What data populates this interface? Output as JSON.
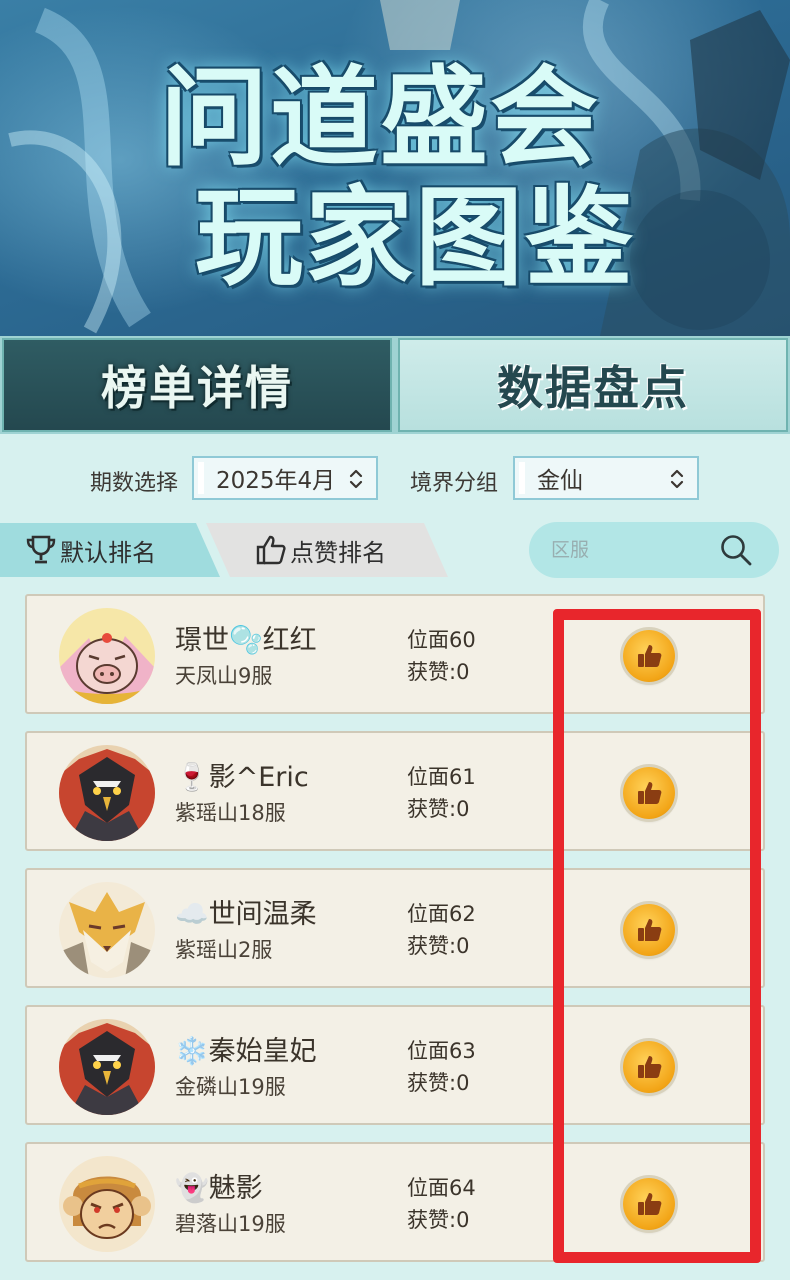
{
  "banner": {
    "title_line1": "问道盛会",
    "title_line2": "玩家图鉴"
  },
  "tabs": {
    "detail": "榜单详情",
    "data": "数据盘点"
  },
  "filters": {
    "period_label": "期数选择",
    "period_value": "2025年4月",
    "realm_label": "境界分组",
    "realm_value": "金仙"
  },
  "sort": {
    "default_label": "默认排名",
    "likes_label": "点赞排名"
  },
  "search": {
    "placeholder": "区服"
  },
  "players": [
    {
      "name": "璟世🫧红红",
      "server": "天凤山9服",
      "rank": "位面60",
      "likes": "获赞:0",
      "avatar_icon": "pig-avatar-icon"
    },
    {
      "name": "🍷影^Eric",
      "server": "紫瑶山18服",
      "rank": "位面61",
      "likes": "获赞:0",
      "avatar_icon": "crow-avatar-icon"
    },
    {
      "name": "☁️世间温柔",
      "server": "紫瑶山2服",
      "rank": "位面62",
      "likes": "获赞:0",
      "avatar_icon": "fox-avatar-icon"
    },
    {
      "name": "❄️秦始皇妃",
      "server": "金磷山19服",
      "rank": "位面63",
      "likes": "获赞:0",
      "avatar_icon": "crow-avatar-icon"
    },
    {
      "name": "👻魅影",
      "server": "碧落山19服",
      "rank": "位面64",
      "likes": "获赞:0",
      "avatar_icon": "monkey-avatar-icon"
    }
  ],
  "colors": {
    "background": "#d7f1ef",
    "card": "#f3f0e6",
    "highlight": "#e8262c",
    "like_gold": "#f2a416"
  }
}
